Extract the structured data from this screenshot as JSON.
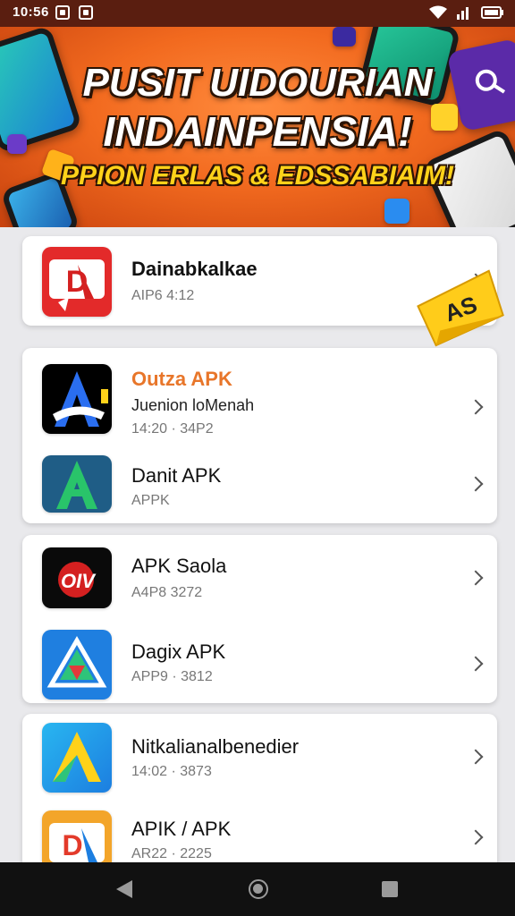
{
  "status_bar": {
    "time": "10:56"
  },
  "banner": {
    "title_line1": "PUSIT UIDOURIAN",
    "title_line2": "INDAINPENSIA!",
    "subtitle": "PPION ERLAS & EDSSABIAIM!"
  },
  "ad_badge": {
    "label": "AS"
  },
  "cards": [
    {
      "items": [
        {
          "name": "Dainabkalkae",
          "meta": "AIP6  4:12",
          "icon": "red-d-app-icon"
        }
      ]
    },
    {
      "items": [
        {
          "name": "Outza APK",
          "subtitle": "Juenion loMenah",
          "meta": "14:20 · 34P2",
          "icon": "blue-a-app-icon",
          "name_color": "#e8762a"
        },
        {
          "name": "Danit APK",
          "meta": "APPK",
          "icon": "green-a-app-icon"
        }
      ]
    },
    {
      "items": [
        {
          "name": "APK Saola",
          "meta": "A4P8  3272",
          "icon": "red-oiv-app-icon"
        },
        {
          "name": "Dagix APK",
          "meta": "APP9 · 3812",
          "icon": "triangle-app-icon"
        }
      ]
    },
    {
      "items": [
        {
          "name": "Nitkalianalbenedier",
          "meta": "14:02 · 3873",
          "icon": "yellow-a-app-icon"
        },
        {
          "name": "APIK / APK",
          "meta": "AR22 · 2225",
          "icon": "orange-d-app-icon"
        }
      ]
    }
  ]
}
